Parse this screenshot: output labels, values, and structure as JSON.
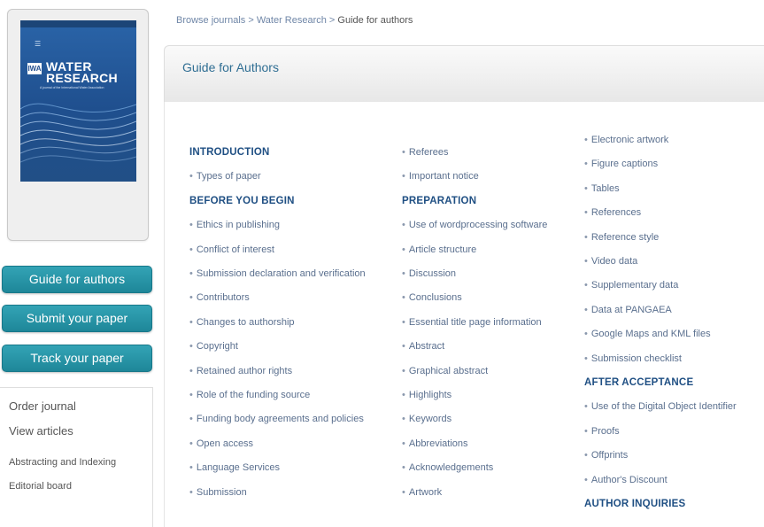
{
  "breadcrumb": {
    "browse": "Browse journals",
    "sep": " > ",
    "journal": "Water Research",
    "current": "Guide for authors"
  },
  "cover": {
    "brand": "IWA",
    "title_line1": "WATER",
    "title_line2": "RESEARCH",
    "subtitle": "A journal of the International Water Association"
  },
  "sidebar": {
    "buttons": [
      "Guide for authors",
      "Submit your paper",
      "Track your paper"
    ],
    "links": [
      "Order journal",
      "View articles"
    ],
    "small_links": [
      "Abstracting and Indexing",
      "Editorial board"
    ]
  },
  "header": {
    "title": "Guide for Authors"
  },
  "toc": {
    "bullet": "•",
    "col1": [
      {
        "type": "head",
        "text": "INTRODUCTION"
      },
      {
        "type": "item",
        "text": "Types of paper"
      },
      {
        "type": "head",
        "text": "BEFORE YOU BEGIN"
      },
      {
        "type": "item",
        "text": "Ethics in publishing"
      },
      {
        "type": "item",
        "text": "Conflict of interest"
      },
      {
        "type": "item",
        "text": "Submission declaration and verification"
      },
      {
        "type": "item",
        "text": "Contributors"
      },
      {
        "type": "item",
        "text": "Changes to authorship"
      },
      {
        "type": "item",
        "text": "Copyright"
      },
      {
        "type": "item",
        "text": "Retained author rights"
      },
      {
        "type": "item",
        "text": "Role of the funding source"
      },
      {
        "type": "item",
        "text": "Funding body agreements and policies"
      },
      {
        "type": "item",
        "text": "Open access"
      },
      {
        "type": "item",
        "text": "Language Services"
      },
      {
        "type": "item",
        "text": "Submission"
      }
    ],
    "col2": [
      {
        "type": "item",
        "text": "Referees"
      },
      {
        "type": "item",
        "text": "Important notice"
      },
      {
        "type": "head",
        "text": "PREPARATION"
      },
      {
        "type": "item",
        "text": "Use of wordprocessing software"
      },
      {
        "type": "item",
        "text": "Article structure"
      },
      {
        "type": "item",
        "text": "Discussion"
      },
      {
        "type": "item",
        "text": "Conclusions"
      },
      {
        "type": "item",
        "text": "Essential title page information"
      },
      {
        "type": "item",
        "text": "Abstract"
      },
      {
        "type": "item",
        "text": "Graphical abstract"
      },
      {
        "type": "item",
        "text": "Highlights"
      },
      {
        "type": "item",
        "text": "Keywords"
      },
      {
        "type": "item",
        "text": "Abbreviations"
      },
      {
        "type": "item",
        "text": "Acknowledgements"
      },
      {
        "type": "item",
        "text": "Artwork"
      }
    ],
    "col3": [
      {
        "type": "item",
        "text": "Electronic artwork"
      },
      {
        "type": "item",
        "text": "Figure captions"
      },
      {
        "type": "item",
        "text": "Tables"
      },
      {
        "type": "item",
        "text": "References"
      },
      {
        "type": "item",
        "text": "Reference style"
      },
      {
        "type": "item",
        "text": "Video data"
      },
      {
        "type": "item",
        "text": "Supplementary data"
      },
      {
        "type": "item",
        "text": "Data at PANGAEA"
      },
      {
        "type": "item",
        "text": "Google Maps and KML files"
      },
      {
        "type": "item",
        "text": "Submission checklist"
      },
      {
        "type": "head",
        "text": "AFTER ACCEPTANCE"
      },
      {
        "type": "item",
        "text": "Use of the Digital Object Identifier"
      },
      {
        "type": "item",
        "text": "Proofs"
      },
      {
        "type": "item",
        "text": "Offprints"
      },
      {
        "type": "item",
        "text": "Author's Discount"
      },
      {
        "type": "head",
        "text": "AUTHOR INQUIRIES"
      }
    ]
  }
}
